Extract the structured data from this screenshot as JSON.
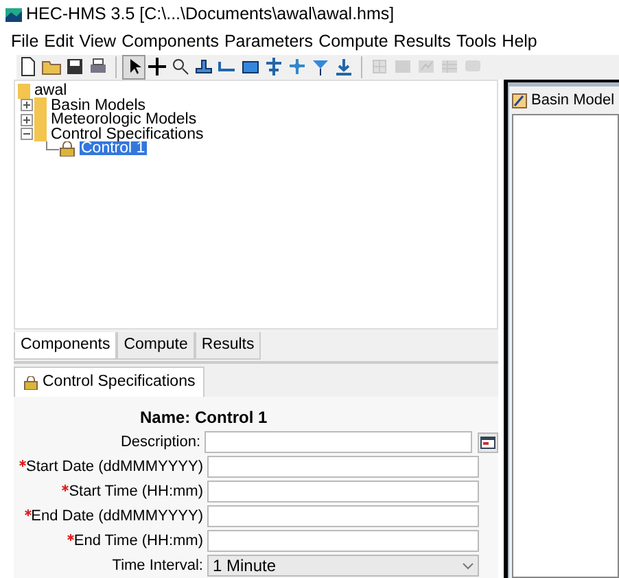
{
  "window": {
    "title": "HEC-HMS 3.5 [C:\\...\\Documents\\awal\\awal.hms]"
  },
  "menu": [
    "File",
    "Edit",
    "View",
    "Components",
    "Parameters",
    "Compute",
    "Results",
    "Tools",
    "Help"
  ],
  "toolbar": [
    {
      "disabled": false,
      "pressed": false
    },
    {
      "disabled": false,
      "pressed": false
    },
    {
      "disabled": false,
      "pressed": false
    },
    {
      "disabled": false,
      "pressed": false
    },
    {
      "disabled": false,
      "pressed": true
    },
    {
      "disabled": false,
      "pressed": false
    },
    {
      "disabled": false,
      "pressed": false
    },
    {
      "disabled": false,
      "pressed": false
    },
    {
      "disabled": false,
      "pressed": false
    },
    {
      "disabled": false,
      "pressed": false
    },
    {
      "disabled": false,
      "pressed": false
    },
    {
      "disabled": false,
      "pressed": false
    },
    {
      "disabled": false,
      "pressed": false
    },
    {
      "disabled": false,
      "pressed": false
    },
    {
      "disabled": true,
      "pressed": false
    },
    {
      "disabled": true,
      "pressed": false
    },
    {
      "disabled": true,
      "pressed": false
    },
    {
      "disabled": true,
      "pressed": false
    },
    {
      "disabled": true,
      "pressed": false
    }
  ],
  "tree": [
    {
      "label": "awal",
      "kind": "folder",
      "selected": false,
      "expanded": true,
      "children": [
        {
          "label": "Basin Models",
          "kind": "folder",
          "selected": false,
          "expanded": false
        },
        {
          "label": "Meteorologic Models",
          "kind": "folder",
          "selected": false,
          "expanded": false
        },
        {
          "label": "Control Specifications",
          "kind": "folder",
          "selected": false,
          "expanded": true,
          "children": [
            {
              "label": "Control 1",
              "kind": "control",
              "selected": true
            }
          ]
        }
      ]
    }
  ],
  "tabs": [
    {
      "label": "Components",
      "selected": true
    },
    {
      "label": "Compute",
      "selected": false
    },
    {
      "label": "Results",
      "selected": false
    }
  ],
  "editor_tab": {
    "label": "Control Specifications",
    "selected": true
  },
  "editor": {
    "name_label": "Name: Control 1",
    "fields": [
      {
        "label": "Description:",
        "kind": "text",
        "required": false,
        "has_button": true
      },
      {
        "label": "Start Date (ddMMMYYYY)",
        "kind": "text",
        "required": true,
        "has_button": false
      },
      {
        "label": "Start Time (HH:mm)",
        "kind": "text",
        "required": true,
        "has_button": false
      },
      {
        "label": "End Date (ddMMMYYYY)",
        "kind": "text",
        "required": true,
        "has_button": false
      },
      {
        "label": "End Time (HH:mm)",
        "kind": "text",
        "required": true,
        "has_button": false
      },
      {
        "label": "Time Interval:",
        "kind": "select",
        "required": false,
        "value": "1 Minute",
        "has_button": false
      }
    ]
  },
  "desktop": {
    "window_title": "Basin Model"
  }
}
